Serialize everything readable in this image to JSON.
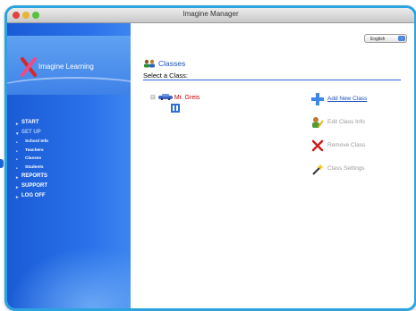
{
  "window": {
    "title": "Imagine Manager"
  },
  "brand": {
    "name": "Imagine Learning"
  },
  "menu": [
    {
      "label": "START",
      "level": "top",
      "active": true
    },
    {
      "label": "SET UP",
      "level": "top",
      "active": false
    },
    {
      "label": "School Info",
      "level": "sub"
    },
    {
      "label": "Teachers",
      "level": "sub"
    },
    {
      "label": "Classes",
      "level": "sub"
    },
    {
      "label": "Students",
      "level": "sub"
    },
    {
      "label": "REPORTS",
      "level": "top",
      "active": true
    },
    {
      "label": "SUPPORT",
      "level": "top",
      "active": true
    },
    {
      "label": "LOG OFF",
      "level": "top",
      "active": true
    }
  ],
  "language_select": {
    "value": "English"
  },
  "page": {
    "title": "Classes",
    "subtitle": "Select a Class:"
  },
  "tree": {
    "class_name": "Mr. Greis"
  },
  "actions": [
    {
      "label": "Add New Class",
      "icon": "plus-icon",
      "enabled": true
    },
    {
      "label": "Edit Class Info",
      "icon": "edit-user-icon",
      "enabled": false
    },
    {
      "label": "Remove Class",
      "icon": "remove-x-icon",
      "enabled": false
    },
    {
      "label": "Class Settings",
      "icon": "wand-icon",
      "enabled": false
    }
  ],
  "colors": {
    "sidebar": "#2b73ea",
    "accent": "#1a4fb8",
    "frame": "#2aa3de",
    "class_name": "#c40000"
  }
}
